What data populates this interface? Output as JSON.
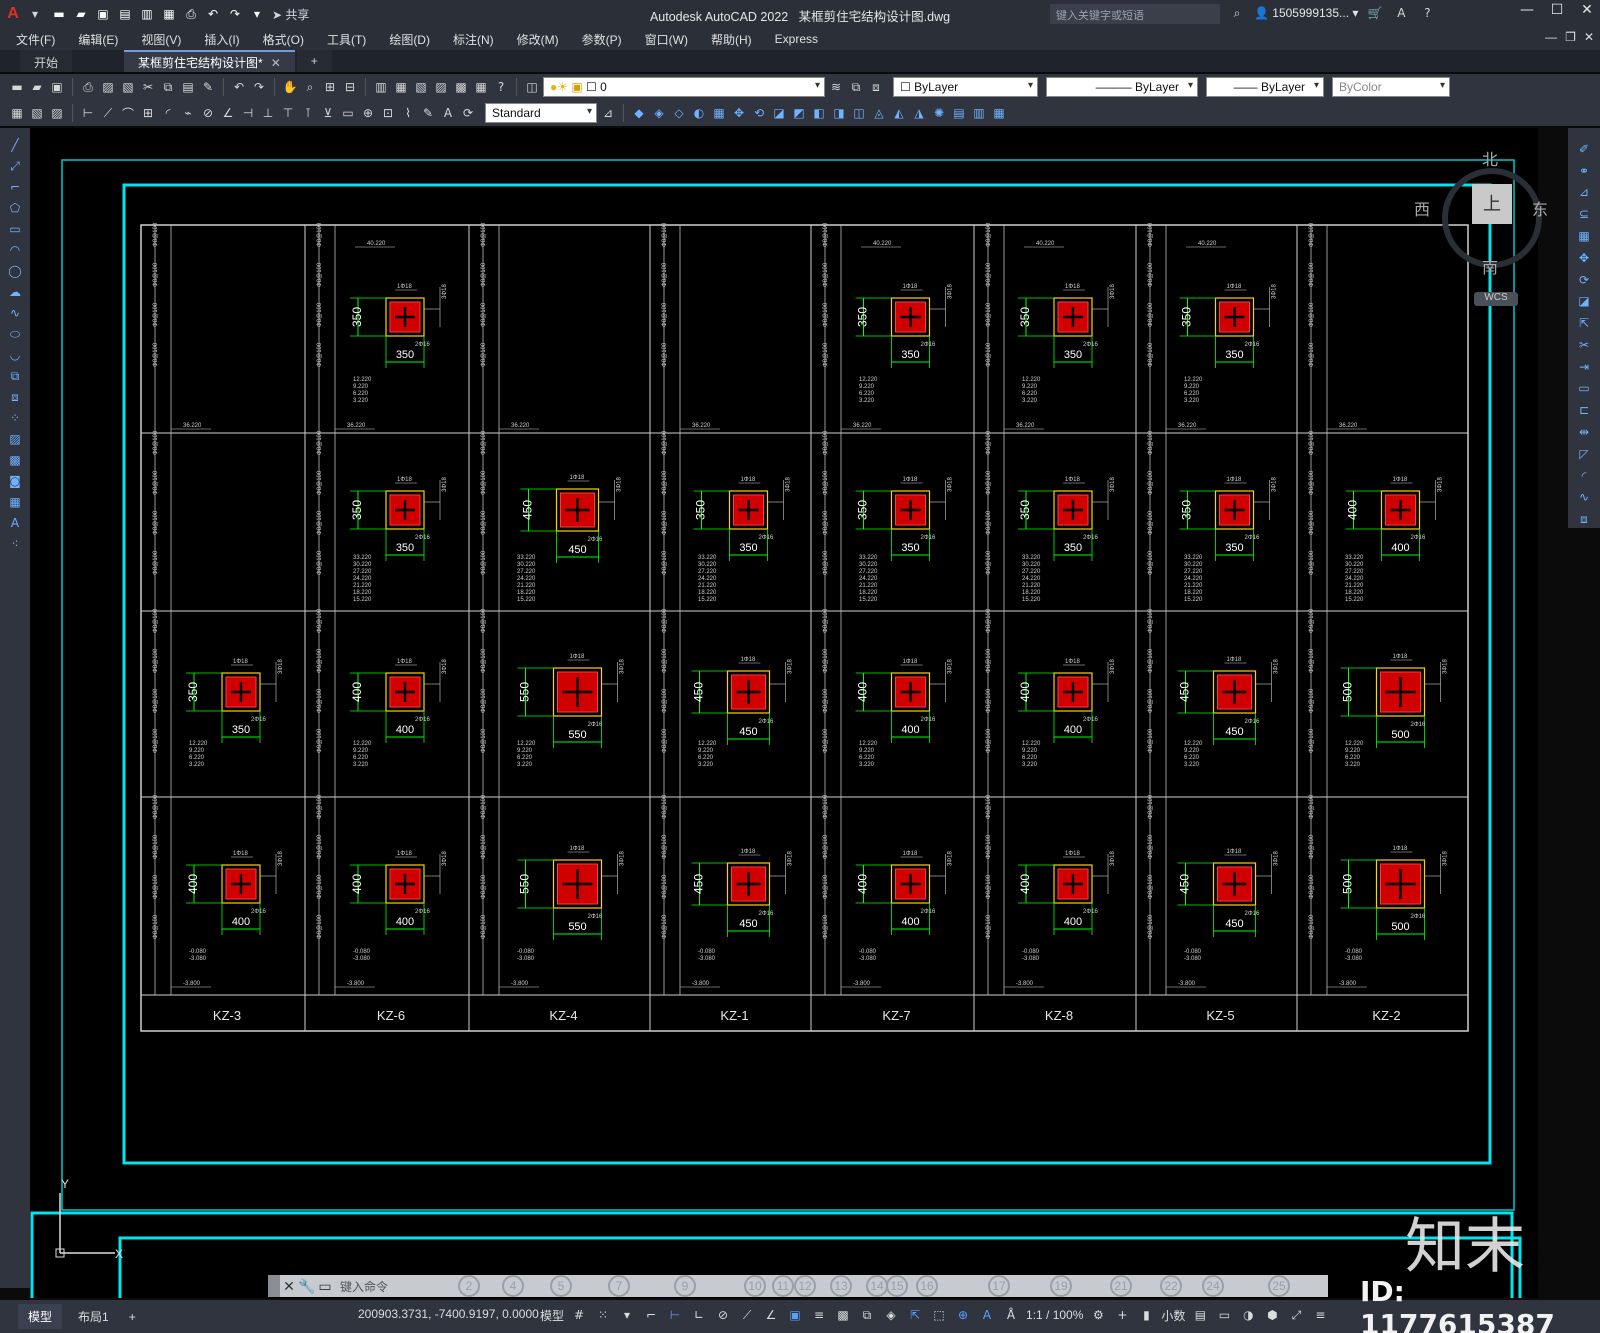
{
  "app": {
    "logo": "A",
    "title": "Autodesk AutoCAD 2022",
    "doc_title": "某框剪住宅结构设计图.dwg",
    "share_label": "共享",
    "search_placeholder": "键入关键字或短语",
    "user": "1505999135..."
  },
  "menu": [
    "文件(F)",
    "编辑(E)",
    "视图(V)",
    "插入(I)",
    "格式(O)",
    "工具(T)",
    "绘图(D)",
    "标注(N)",
    "修改(M)",
    "参数(P)",
    "窗口(W)",
    "帮助(H)",
    "Express"
  ],
  "tabs": {
    "start": "开始",
    "active": "某框剪住宅结构设计图*"
  },
  "toolbar": {
    "layer_value": "0",
    "color_value": "ByLayer",
    "linetype_value": "ByLayer",
    "lineweight_value": "ByLayer",
    "plotstyle_value": "ByColor",
    "textstyle_value": "Standard"
  },
  "viewcube": {
    "north": "北",
    "south": "南",
    "west": "西",
    "east": "东",
    "top": "上",
    "wcs": "WCS"
  },
  "ucs": {
    "y": "Y",
    "x": "X"
  },
  "drawing": {
    "columns": [
      "KZ-3",
      "KZ-6",
      "KZ-4",
      "KZ-1",
      "KZ-7",
      "KZ-8",
      "KZ-5",
      "KZ-2"
    ],
    "sections": [
      [
        "",
        "350",
        "",
        "",
        "350",
        "350",
        "350",
        ""
      ],
      [
        "",
        "350",
        "450",
        "350",
        "350",
        "350",
        "350",
        "400"
      ],
      [
        "350",
        "400",
        "550",
        "450",
        "400",
        "400",
        "450",
        "500"
      ],
      [
        "400",
        "400",
        "550",
        "450",
        "400",
        "400",
        "450",
        "500"
      ]
    ],
    "levels": [
      "40.220",
      "36.220",
      "33.220",
      "30.220",
      "27.220",
      "24.220",
      "21.220",
      "18.220",
      "15.220",
      "12.220",
      "9.220",
      "6.220",
      "3.220",
      "-0.080",
      "-3.080",
      "-3.800"
    ],
    "rebar_labels": [
      "1Φ18",
      "1Φ16",
      "1Φ20",
      "1Φ25",
      "2Φ16",
      "3Φ18"
    ]
  },
  "command": {
    "placeholder": "键入命令",
    "nums": [
      "2",
      "4",
      "5",
      "7",
      "9",
      "10",
      "11",
      "12",
      "13",
      "14",
      "15",
      "16",
      "17",
      "19",
      "21",
      "22",
      "24",
      "25"
    ]
  },
  "status": {
    "tabs": [
      "模型",
      "布局1"
    ],
    "coords": "200903.3731, -7400.9197, 0.0000",
    "mode": "模型",
    "scale": "1:1 / 100%",
    "units": "小数"
  },
  "watermark": {
    "brand": "知末",
    "id": "ID: 1177615387"
  },
  "colors": {
    "accent": "#00e5ee",
    "column": "#d00000",
    "rebar": "#00ff00",
    "yellow": "#ffd200"
  }
}
